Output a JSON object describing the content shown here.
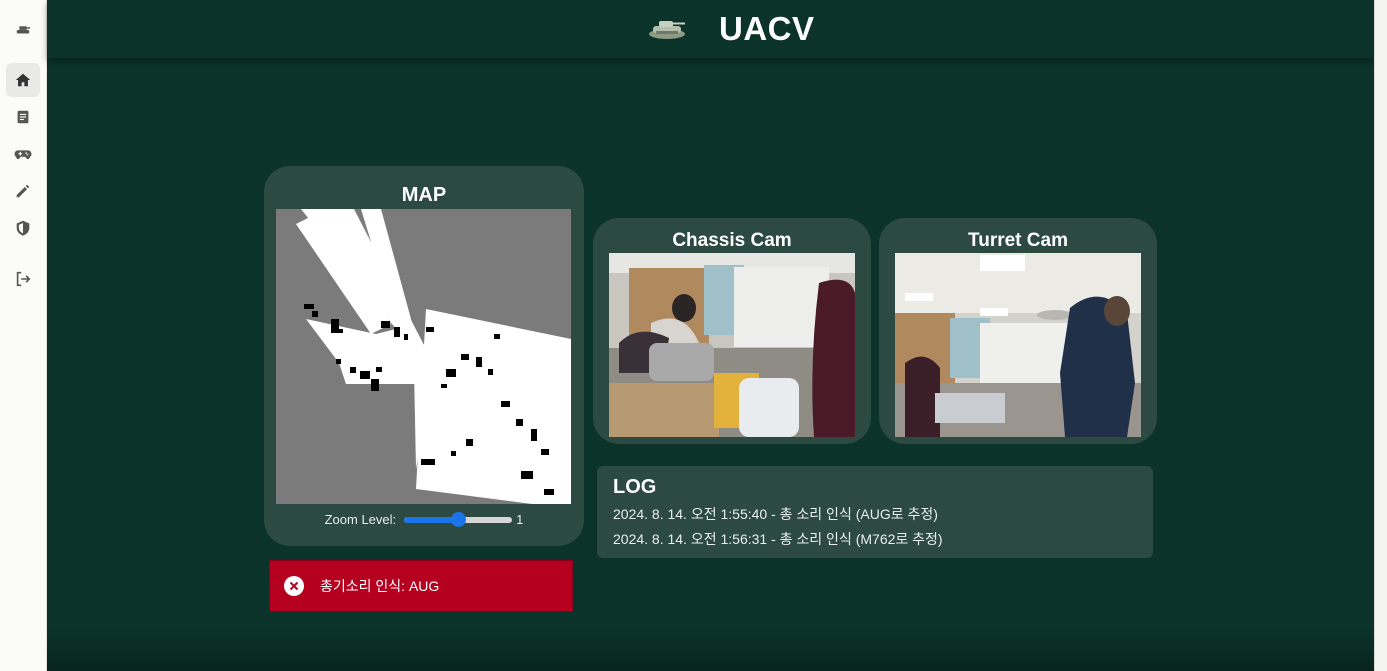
{
  "header": {
    "title": "UACV",
    "logo_icon": "tank-logo-icon"
  },
  "sidebar": {
    "items": [
      {
        "name": "tank-icon",
        "active": false
      },
      {
        "name": "home-icon",
        "active": true
      },
      {
        "name": "document-icon",
        "active": false
      },
      {
        "name": "gamepad-icon",
        "active": false
      },
      {
        "name": "pencil-icon",
        "active": false
      },
      {
        "name": "shield-icon",
        "active": false
      },
      {
        "name": "logout-icon",
        "active": false
      }
    ]
  },
  "map": {
    "title": "MAP",
    "zoom_label": "Zoom Level:",
    "zoom_value": "1",
    "zoom_fraction": 0.5
  },
  "cameras": {
    "chassis": {
      "title": "Chassis Cam"
    },
    "turret": {
      "title": "Turret Cam"
    }
  },
  "log": {
    "title": "LOG",
    "entries": [
      "2024. 8. 14. 오전 1:55:40 - 총 소리 인식 (AUG로 추정)",
      "2024. 8. 14. 오전 1:56:31 - 총 소리 인식 (M762로 추정)"
    ]
  },
  "alert": {
    "text": "총기소리 인식: AUG",
    "icon": "close-circle-icon",
    "color": "#b50020"
  },
  "colors": {
    "background": "#0b3329",
    "card": "#2c4a41",
    "accent": "#1b74e8"
  }
}
